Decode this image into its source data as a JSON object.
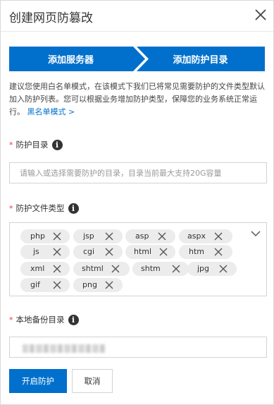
{
  "dialog": {
    "title": "创建网页防篡改"
  },
  "steps": [
    {
      "label": "添加服务器"
    },
    {
      "label": "添加防护目录"
    }
  ],
  "colors": {
    "primary": "#0070cc",
    "required": "#e4393c",
    "tag_bg": "#ececec"
  },
  "tip": {
    "text": "建议您使用白名单模式，在该模式下我们已将常见需要防护的文件类型默认加入防护列表。您可以根据业务增加防护类型，保障您的业务系统正常运行。",
    "link": "黑名单模式 >"
  },
  "fields": {
    "dir": {
      "label": "防护目录",
      "placeholder": "请输入或选择需要防护的目录，目录当前最大支持20G容量",
      "value": ""
    },
    "types": {
      "label": "防护文件类型",
      "tags": [
        "php",
        "jsp",
        "asp",
        "aspx",
        "js",
        "cgi",
        "html",
        "htm",
        "xml",
        "shtml",
        "shtm",
        "jpg",
        "gif",
        "png"
      ]
    },
    "backup": {
      "label": "本地备份目录"
    }
  },
  "icons": {
    "close": "close-icon",
    "info": "info-icon",
    "tag_remove": "close-icon",
    "dropdown": "chevron-down-icon"
  },
  "buttons": {
    "submit": "开启防护",
    "cancel": "取消"
  }
}
